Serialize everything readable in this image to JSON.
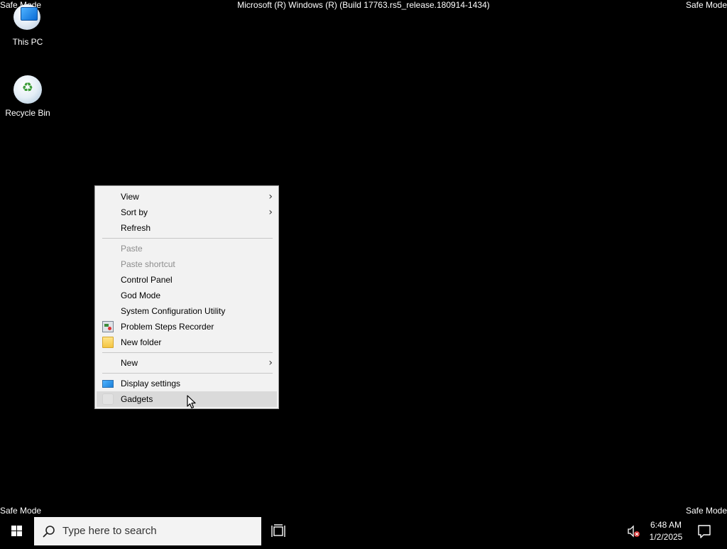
{
  "desktop": {
    "build_title": "Microsoft (R) Windows (R) (Build 17763.rs5_release.180914-1434)",
    "safe_mode": "Safe Mode",
    "background_color": "#000000",
    "icons": [
      {
        "label": "This PC",
        "icon": "this-pc-icon"
      },
      {
        "label": "Recycle Bin",
        "icon": "recycle-bin-icon"
      }
    ]
  },
  "context_menu": {
    "items": [
      {
        "label": "View",
        "submenu": true
      },
      {
        "label": "Sort by",
        "submenu": true
      },
      {
        "label": "Refresh"
      },
      {
        "label": "Paste",
        "disabled": true
      },
      {
        "label": "Paste shortcut",
        "disabled": true
      },
      {
        "label": "Control Panel"
      },
      {
        "label": "God Mode"
      },
      {
        "label": "System Configuration Utility"
      },
      {
        "label": "Problem Steps Recorder",
        "icon": "steps-recorder-icon"
      },
      {
        "label": "New folder",
        "icon": "folder-icon"
      },
      {
        "label": "New",
        "submenu": true
      },
      {
        "label": "Display settings",
        "icon": "display-icon"
      },
      {
        "label": "Gadgets",
        "icon": "gadgets-icon",
        "highlighted": true
      }
    ],
    "submenu_arrow": ">"
  },
  "taskbar": {
    "search_placeholder": "Type here to search",
    "clock_time": "6:48 AM",
    "clock_date": "1/2/2025"
  }
}
